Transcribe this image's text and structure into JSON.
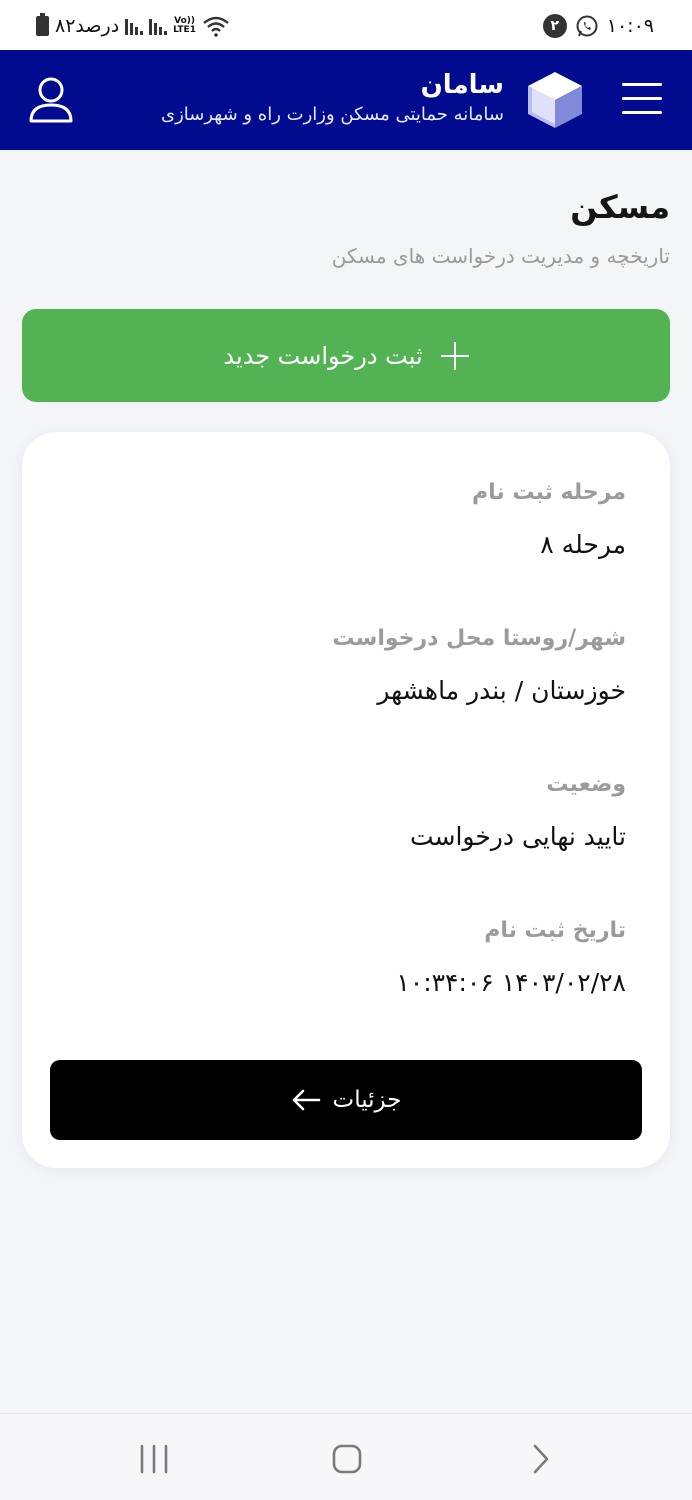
{
  "status_bar": {
    "battery_text": "۸۲درصد",
    "network_label": "LTE1",
    "volte_label": "Vo))",
    "notification_count": "۲",
    "time": "۱۰:۰۹"
  },
  "header": {
    "brand_title": "سامان",
    "brand_subtitle": "سامانه حمایتی مسکن وزارت راه و شهرسازی",
    "bg_color": "#000b8f"
  },
  "page": {
    "title": "مسکن",
    "subtitle": "تاریخچه و مدیریت درخواست های مسکن"
  },
  "new_request_button": {
    "label": "ثبت درخواست جدید",
    "color": "#53b253"
  },
  "request_card": {
    "fields": [
      {
        "label": "مرحله ثبت نام",
        "value": "مرحله ۸"
      },
      {
        "label": "شهر/روستا محل درخواست",
        "value": "خوزستان / بندر ماهشهر"
      },
      {
        "label": "وضعیت",
        "value": "تایید نهایی درخواست"
      },
      {
        "label": "تاریخ ثبت نام",
        "value": "۱۴۰۳/۰۲/۲۸ ۱۰:۳۴:۰۶"
      }
    ],
    "details_button": {
      "label": "جزئیات"
    }
  },
  "icons": {
    "menu": "hamburger-icon",
    "logo": "box-logo-icon",
    "user": "user-icon",
    "add": "plus-icon",
    "arrow": "arrow-left-icon",
    "recents": "recents-icon",
    "home": "home-icon",
    "back": "back-icon"
  }
}
